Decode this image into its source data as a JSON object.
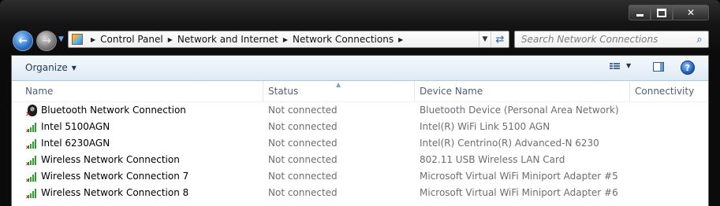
{
  "caption": {
    "minimize_glyph": "minimize-glyph",
    "maximize_glyph": "maximize-glyph",
    "close_label": "✕"
  },
  "nav": {
    "back_icon": "back-arrow-icon",
    "forward_icon": "forward-arrow-icon",
    "breadcrumbs": [
      "Control Panel",
      "Network and Internet",
      "Network Connections"
    ]
  },
  "search": {
    "placeholder": "Search Network Connections"
  },
  "toolbar": {
    "organize_label": "Organize"
  },
  "columns": {
    "name": "Name",
    "status": "Status",
    "device": "Device Name",
    "connectivity": "Connectivity"
  },
  "connections": [
    {
      "name": "Bluetooth Network Connection",
      "status": "Not connected",
      "device": "Bluetooth Device (Personal Area Network)",
      "icon": "bluetooth-icon"
    },
    {
      "name": "Intel 5100AGN",
      "status": "Not connected",
      "device": "Intel(R) WiFi Link 5100 AGN",
      "icon": "wireless-signal-icon"
    },
    {
      "name": "Intel 6230AGN",
      "status": "Not connected",
      "device": "Intel(R) Centrino(R) Advanced-N 6230",
      "icon": "wireless-signal-icon"
    },
    {
      "name": "Wireless Network Connection",
      "status": "Not connected",
      "device": "802.11 USB Wireless LAN Card",
      "icon": "wireless-signal-icon"
    },
    {
      "name": "Wireless Network Connection 7",
      "status": "Not connected",
      "device": "Microsoft Virtual WiFi Miniport Adapter #5",
      "icon": "wireless-signal-icon"
    },
    {
      "name": "Wireless Network Connection 8",
      "status": "Not connected",
      "device": "Microsoft Virtual WiFi Miniport Adapter #6",
      "icon": "wireless-signal-icon"
    }
  ],
  "colors": {
    "accent": "#1e395b",
    "signal_green": "#2e9e2e",
    "disconnected_red": "#d40000"
  }
}
